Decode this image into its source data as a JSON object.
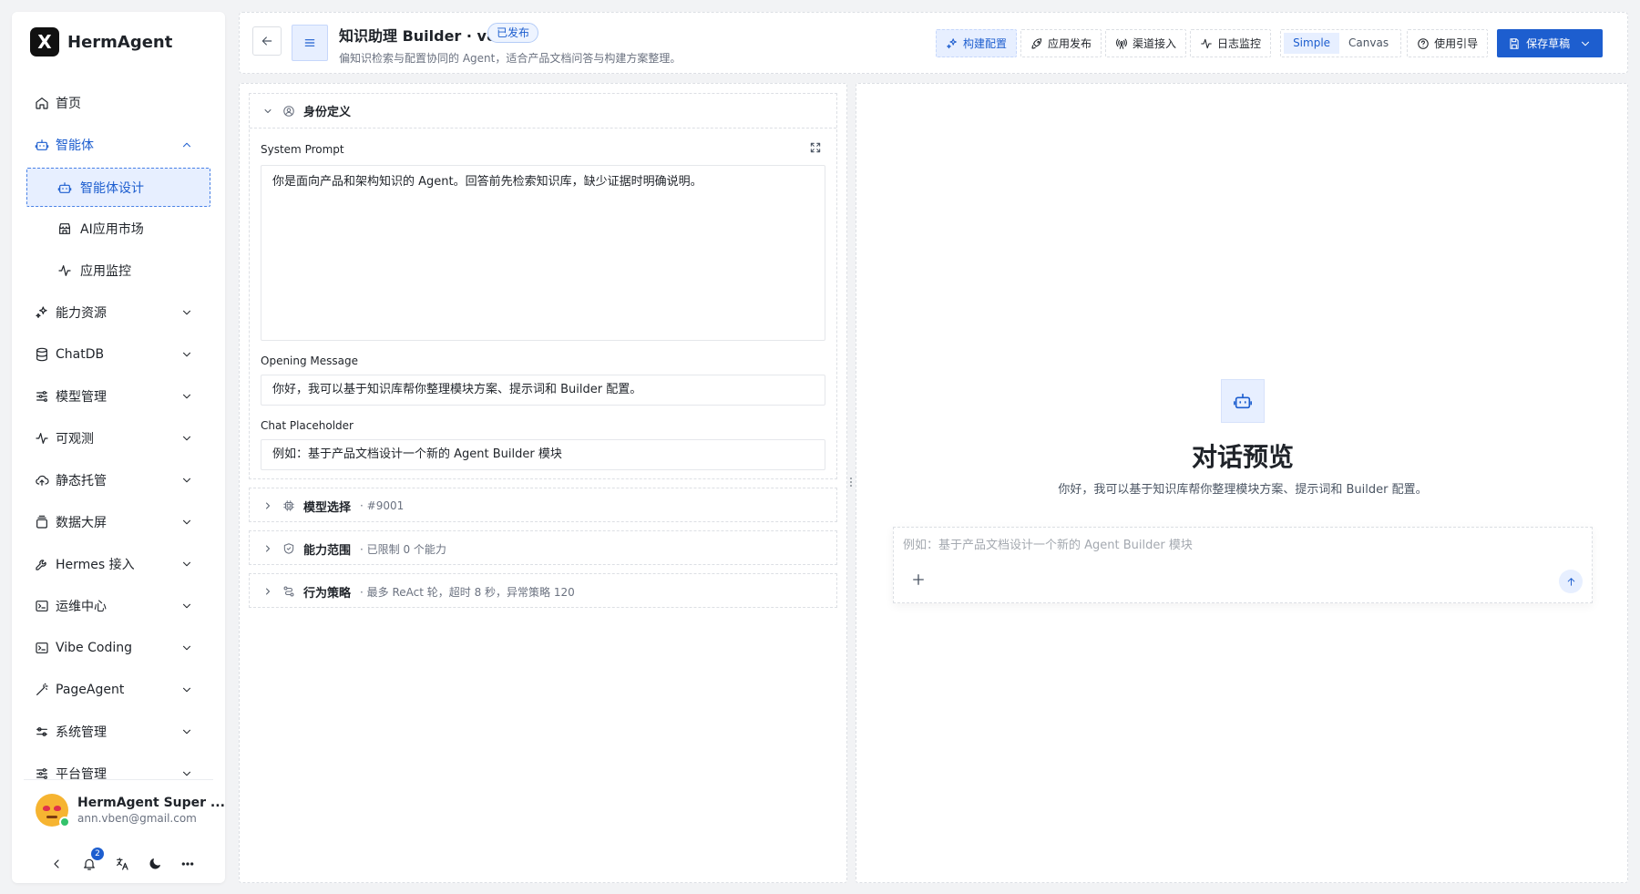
{
  "app": {
    "logo_letter": "X",
    "name": "HermAgent"
  },
  "sidebar": {
    "items": [
      {
        "label": "首页",
        "icon": "home-icon",
        "expandable": false
      },
      {
        "label": "智能体",
        "icon": "robot-icon",
        "expandable": true,
        "expanded": true
      },
      {
        "label": "能力资源",
        "icon": "sparkle-icon",
        "expandable": true
      },
      {
        "label": "ChatDB",
        "icon": "database-icon",
        "expandable": true
      },
      {
        "label": "模型管理",
        "icon": "sliders-icon",
        "expandable": true
      },
      {
        "label": "可观测",
        "icon": "activity-icon",
        "expandable": true
      },
      {
        "label": "静态托管",
        "icon": "cloud-upload-icon",
        "expandable": true
      },
      {
        "label": "数据大屏",
        "icon": "stack-icon",
        "expandable": true
      },
      {
        "label": "Hermes 接入",
        "icon": "wrench-icon",
        "expandable": true
      },
      {
        "label": "运维中心",
        "icon": "terminal-icon",
        "expandable": true
      },
      {
        "label": "Vibe Coding",
        "icon": "code-window-icon",
        "expandable": true
      },
      {
        "label": "PageAgent",
        "icon": "wand-icon",
        "expandable": true
      },
      {
        "label": "系统管理",
        "icon": "toggle-settings-icon",
        "expandable": true
      },
      {
        "label": "平台管理",
        "icon": "sliders-icon",
        "expandable": true
      }
    ],
    "sub_items": [
      {
        "label": "智能体设计",
        "icon": "robot-icon",
        "active": true
      },
      {
        "label": "AI应用市场",
        "icon": "store-icon",
        "active": false
      },
      {
        "label": "应用监控",
        "icon": "activity-icon",
        "active": false
      }
    ],
    "user": {
      "name": "HermAgent Super ...",
      "email": "ann.vben@gmail.com",
      "notification_count": "2"
    }
  },
  "header": {
    "title": "知识助理 Builder · v8",
    "status": "已发布",
    "description": "偏知识检索与配置协同的 Agent，适合产品文档问答与构建方案整理。",
    "toolbar": [
      {
        "label": "构建配置",
        "icon": "sparkle-icon",
        "active": true
      },
      {
        "label": "应用发布",
        "icon": "rocket-icon",
        "active": false
      },
      {
        "label": "渠道接入",
        "icon": "broadcast-icon",
        "active": false
      },
      {
        "label": "日志监控",
        "icon": "activity-icon",
        "active": false
      }
    ],
    "mode_toggle": [
      "Simple",
      "Canvas"
    ],
    "mode_selected": "Simple",
    "guide_label": "使用引导",
    "save_label": "保存草稿"
  },
  "config": {
    "identity": {
      "title": "身份定义",
      "system_prompt_label": "System Prompt",
      "system_prompt_value": "你是面向产品和架构知识的 Agent。回答前先检索知识库，缺少证据时明确说明。",
      "opening_label": "Opening Message",
      "opening_value": "你好，我可以基于知识库帮你整理模块方案、提示词和 Builder 配置。",
      "placeholder_label": "Chat Placeholder",
      "placeholder_value": "例如：基于产品文档设计一个新的 Agent Builder 模块"
    },
    "model": {
      "title": "模型选择",
      "meta": "· #9001"
    },
    "scope": {
      "title": "能力范围",
      "meta": "· 已限制 0 个能力"
    },
    "behavior": {
      "title": "行为策略",
      "meta": "· 最多 ReAct 轮，超时 8 秒，异常策略 120"
    }
  },
  "preview": {
    "title": "对话预览",
    "subtitle": "你好，我可以基于知识库帮你整理模块方案、提示词和 Builder 配置。",
    "input_placeholder": "例如：基于产品文档设计一个新的 Agent Builder 模块"
  },
  "colors": {
    "accent": "#1d5ecf",
    "accent_bg": "#e7efff"
  }
}
